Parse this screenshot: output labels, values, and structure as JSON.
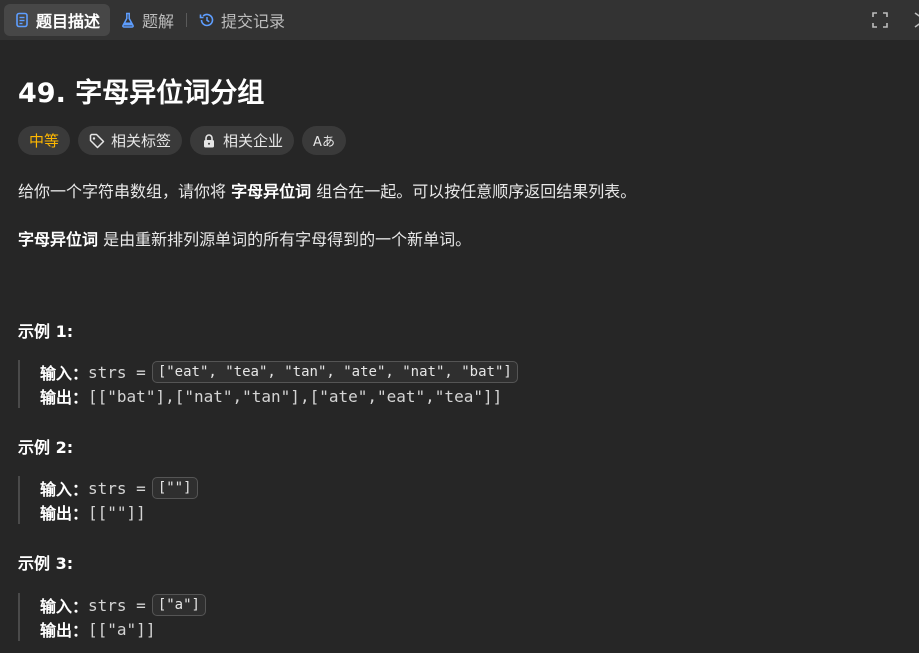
{
  "tabs": [
    {
      "label": "题目描述",
      "icon": "description-icon",
      "active": true
    },
    {
      "label": "题解",
      "icon": "flask-icon",
      "active": false
    },
    {
      "label": "提交记录",
      "icon": "history-icon",
      "active": false
    }
  ],
  "problem": {
    "title": "49. 字母异位词分组",
    "tags": {
      "difficulty": "中等",
      "related_tags": "相关标签",
      "related_companies": "相关企业",
      "translate": "Aあ"
    },
    "desc1_pre": "给你一个字符串数组，请你将 ",
    "desc1_bold": "字母异位词",
    "desc1_post": " 组合在一起。可以按任意顺序返回结果列表。",
    "desc2_bold": "字母异位词",
    "desc2_post": " 是由重新排列源单词的所有字母得到的一个新单词。"
  },
  "examples": [
    {
      "title": "示例 1:",
      "input_label": "输入：",
      "input_var": "strs = ",
      "input_value": "[\"eat\", \"tea\", \"tan\", \"ate\", \"nat\", \"bat\"]",
      "output_label": "输出：",
      "output_value": "[[\"bat\"],[\"nat\",\"tan\"],[\"ate\",\"eat\",\"tea\"]]"
    },
    {
      "title": "示例 2:",
      "input_label": "输入：",
      "input_var": "strs = ",
      "input_value": "[\"\"]",
      "output_label": "输出：",
      "output_value": "[[\"\"]]"
    },
    {
      "title": "示例 3:",
      "input_label": "输入：",
      "input_var": "strs = ",
      "input_value": "[\"a\"]",
      "output_label": "输出：",
      "output_value": "[[\"a\"]]"
    }
  ],
  "colors": {
    "background": "#262626",
    "tabbar": "#333333",
    "difficulty": "#ffb800",
    "tab_icon_blue": "#5e9eff"
  }
}
